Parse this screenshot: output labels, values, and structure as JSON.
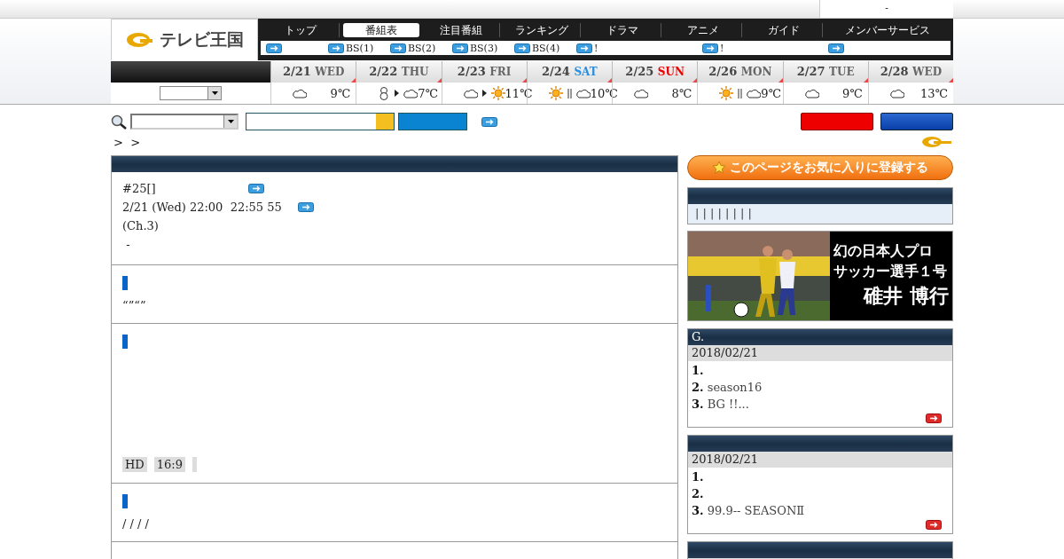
{
  "top_bar": {
    "text": "-"
  },
  "logo": {
    "text": "テレビ王国"
  },
  "nav": {
    "tabs": [
      {
        "label": "トップ",
        "selected": false
      },
      {
        "label": "番組表",
        "selected": true
      },
      {
        "label": "注目番組",
        "selected": false
      },
      {
        "label": "ランキング",
        "selected": false
      },
      {
        "label": "ドラマ",
        "selected": false
      },
      {
        "label": "アニメ",
        "selected": false
      },
      {
        "label": "ガイド",
        "selected": false
      },
      {
        "label": "メンバーサービス",
        "selected": false
      }
    ],
    "links": [
      {
        "kind": "icon"
      },
      {
        "kind": "labeled",
        "label": "BS(1)"
      },
      {
        "kind": "labeled",
        "label": "BS(2)"
      },
      {
        "kind": "labeled",
        "label": "BS(3)"
      },
      {
        "kind": "labeled",
        "label": "BS(4)"
      },
      {
        "kind": "labeled",
        "label": "!"
      },
      {
        "kind": "labeled",
        "label": "!"
      },
      {
        "kind": "icon"
      }
    ]
  },
  "days": [
    {
      "date": "2/21",
      "day": "WED",
      "kind": "weekday",
      "weather": [
        {
          "kind": "cloud"
        }
      ],
      "temp": "9℃"
    },
    {
      "date": "2/22",
      "day": "THU",
      "kind": "weekday",
      "weather": [
        {
          "kind": "snow"
        },
        {
          "kind": "then"
        },
        {
          "kind": "cloud"
        }
      ],
      "temp": "7℃"
    },
    {
      "date": "2/23",
      "day": "FRI",
      "kind": "weekday",
      "weather": [
        {
          "kind": "cloud"
        },
        {
          "kind": "then"
        },
        {
          "kind": "sun"
        }
      ],
      "temp": "11℃"
    },
    {
      "date": "2/24",
      "day": "SAT",
      "kind": "saturday",
      "weather": [
        {
          "kind": "sun"
        },
        {
          "kind": "or"
        },
        {
          "kind": "cloud"
        }
      ],
      "temp": "10℃"
    },
    {
      "date": "2/25",
      "day": "SUN",
      "kind": "sunday",
      "weather": [
        {
          "kind": "cloud"
        }
      ],
      "temp": "8℃"
    },
    {
      "date": "2/26",
      "day": "MON",
      "kind": "weekday",
      "weather": [
        {
          "kind": "sun"
        },
        {
          "kind": "or"
        },
        {
          "kind": "cloud"
        }
      ],
      "temp": "9℃"
    },
    {
      "date": "2/27",
      "day": "TUE",
      "kind": "weekday",
      "weather": [
        {
          "kind": "cloud"
        }
      ],
      "temp": "9℃"
    },
    {
      "date": "2/28",
      "day": "WED",
      "kind": "weekday",
      "weather": [
        {
          "kind": "cloud"
        }
      ],
      "temp": "13℃"
    }
  ],
  "breadcrumb": ">  >",
  "program": {
    "title": "#25[]",
    "time": "2/21 (Wed) 22:00  22:55 55",
    "channel": "(Ch.3)",
    "note": "-"
  },
  "sections": [
    {
      "kind": "text",
      "text": "“”“”"
    },
    {
      "kind": "tags",
      "tags": [
        "HD",
        "16:9"
      ],
      "blank_tag": true
    },
    {
      "kind": "text",
      "text": "/ / / /"
    }
  ],
  "sidebar": {
    "favorite": "このページをお気に入りに登録する",
    "categories": "| | | | | | | |",
    "banner": [
      "幻の日本人プロ",
      "サッカー選手１号",
      "碓井 博行"
    ],
    "rankings": [
      {
        "title": "G.",
        "date": "2018/02/21",
        "items": [
          {
            "rank": "1."
          },
          {
            "rank": "2.",
            "text": "season16"
          },
          {
            "rank": "3.",
            "text": "BG !!..."
          }
        ]
      },
      {
        "date": "2018/02/21",
        "items": [
          {
            "rank": "1."
          },
          {
            "rank": "2."
          },
          {
            "rank": "3.",
            "text": "99.9-- SEASONⅡ"
          }
        ]
      }
    ]
  }
}
